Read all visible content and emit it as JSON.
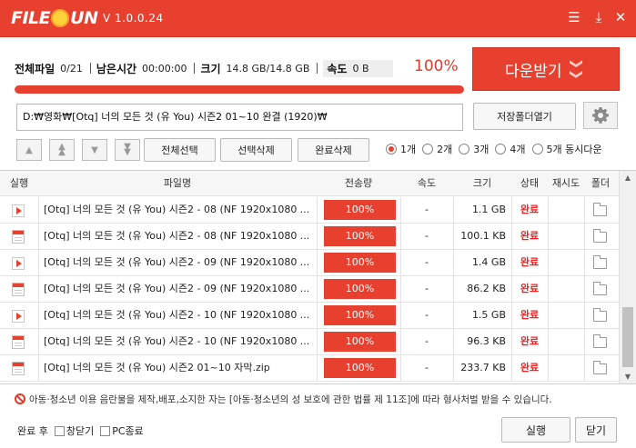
{
  "app": {
    "logo_left": "FILE",
    "logo_right": "UN",
    "version": "V 1.0.0.24"
  },
  "window_controls": {
    "menu_glyph": "☰",
    "download_glyph": "⤓",
    "close_glyph": "✕"
  },
  "stats": {
    "total_files_label": "전체파일",
    "total_files_value": "0/21",
    "remaining_label": "남은시간",
    "remaining_value": "00:00:00",
    "size_label": "크기",
    "size_value": "14.8 GB/14.8 GB",
    "speed_label": "속도",
    "speed_value": "0 B",
    "percent": "100%",
    "progress_fraction": 1.0
  },
  "download_button": {
    "label": "다운받기",
    "chevron": "❯❯"
  },
  "path": {
    "value": "D:₩영화₩[Otq] 너의 모든 것 (유 You) 시즌2 01~10 완결 (1920)₩",
    "open_folder_label": "저장폴더열기"
  },
  "toolbar": {
    "select_all": "전체선택",
    "delete_selected": "선택삭제",
    "delete_completed": "완료삭제",
    "concurrency": [
      {
        "label": "1개",
        "selected": true
      },
      {
        "label": "2개",
        "selected": false
      },
      {
        "label": "3개",
        "selected": false
      },
      {
        "label": "4개",
        "selected": false
      },
      {
        "label": "5개 동시다운",
        "selected": false
      }
    ]
  },
  "table": {
    "headers": {
      "run": "실행",
      "filename": "파일명",
      "transferred": "전송량",
      "speed": "속도",
      "size": "크기",
      "status": "상태",
      "retry": "재시도",
      "folder": "폴더"
    },
    "rows": [
      {
        "icon": "play",
        "name": "[Otq] 너의 모든 것 (유 You) 시즌2 - 08 (NF 1920x1080 ...",
        "progress": "100%",
        "speed": "-",
        "size": "1.1 GB",
        "status": "완료",
        "retry": ""
      },
      {
        "icon": "doc",
        "name": "[Otq] 너의 모든 것 (유 You) 시즌2 - 08 (NF 1920x1080 ...",
        "progress": "100%",
        "speed": "-",
        "size": "100.1 KB",
        "status": "완료",
        "retry": ""
      },
      {
        "icon": "play",
        "name": "[Otq] 너의 모든 것 (유 You) 시즌2 - 09 (NF 1920x1080 ...",
        "progress": "100%",
        "speed": "-",
        "size": "1.4 GB",
        "status": "완료",
        "retry": ""
      },
      {
        "icon": "doc",
        "name": "[Otq] 너의 모든 것 (유 You) 시즌2 - 09 (NF 1920x1080 ...",
        "progress": "100%",
        "speed": "-",
        "size": "86.2 KB",
        "status": "완료",
        "retry": ""
      },
      {
        "icon": "play",
        "name": "[Otq] 너의 모든 것 (유 You) 시즌2 - 10 (NF 1920x1080 ...",
        "progress": "100%",
        "speed": "-",
        "size": "1.5 GB",
        "status": "완료",
        "retry": ""
      },
      {
        "icon": "doc",
        "name": "[Otq] 너의 모든 것 (유 You) 시즌2 - 10 (NF 1920x1080 ...",
        "progress": "100%",
        "speed": "-",
        "size": "96.3 KB",
        "status": "완료",
        "retry": ""
      },
      {
        "icon": "doc",
        "name": "[Otq] 너의 모든 것 (유 You) 시즌2 01~10 자막.zip",
        "progress": "100%",
        "speed": "-",
        "size": "233.7 KB",
        "status": "완료",
        "retry": ""
      }
    ]
  },
  "notice": "아동·청소년 이용 음란물을 제작,배포,소지한 자는 [아동·청소년의 성 보호에 관한 법률 제 11조]에 따라 형사처벌 받을 수 있습니다.",
  "footer": {
    "after_complete_label": "완료 후",
    "close_window_label": "창닫기",
    "pc_shutdown_label": "PC종료",
    "run_label": "실행",
    "close_label": "닫기"
  },
  "colors": {
    "accent": "#e8402f",
    "status_done": "#ee2222"
  }
}
